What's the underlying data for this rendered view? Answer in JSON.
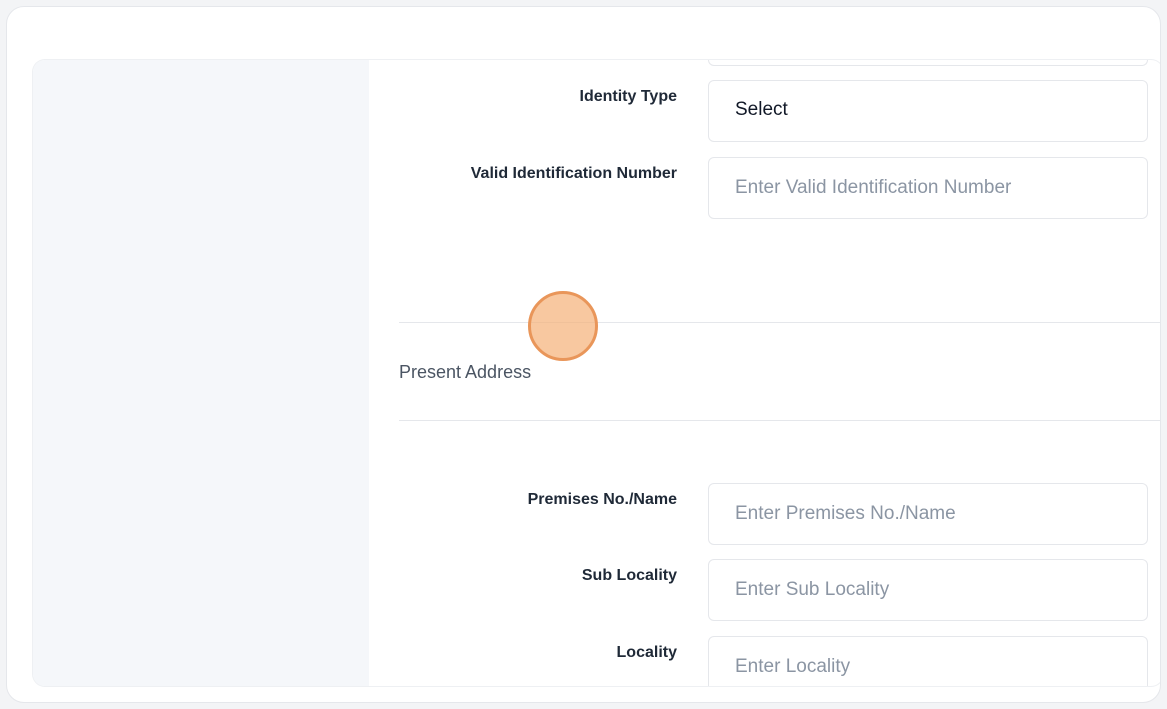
{
  "form": {
    "identity_type": {
      "label": "Identity Type",
      "value": "Select"
    },
    "valid_id_number": {
      "label": "Valid Identification Number",
      "placeholder": "Enter Valid Identification Number"
    },
    "present_address_title": "Present Address",
    "premises": {
      "label": "Premises No./Name",
      "placeholder": "Enter Premises No./Name"
    },
    "sub_locality": {
      "label": "Sub Locality",
      "placeholder": "Enter Sub Locality"
    },
    "locality": {
      "label": "Locality",
      "placeholder": "Enter Locality"
    }
  },
  "colors": {
    "sidebar_bg": "#f5f7fa",
    "field_border": "#e5e7eb",
    "cursor_highlight": "#f5b178"
  }
}
